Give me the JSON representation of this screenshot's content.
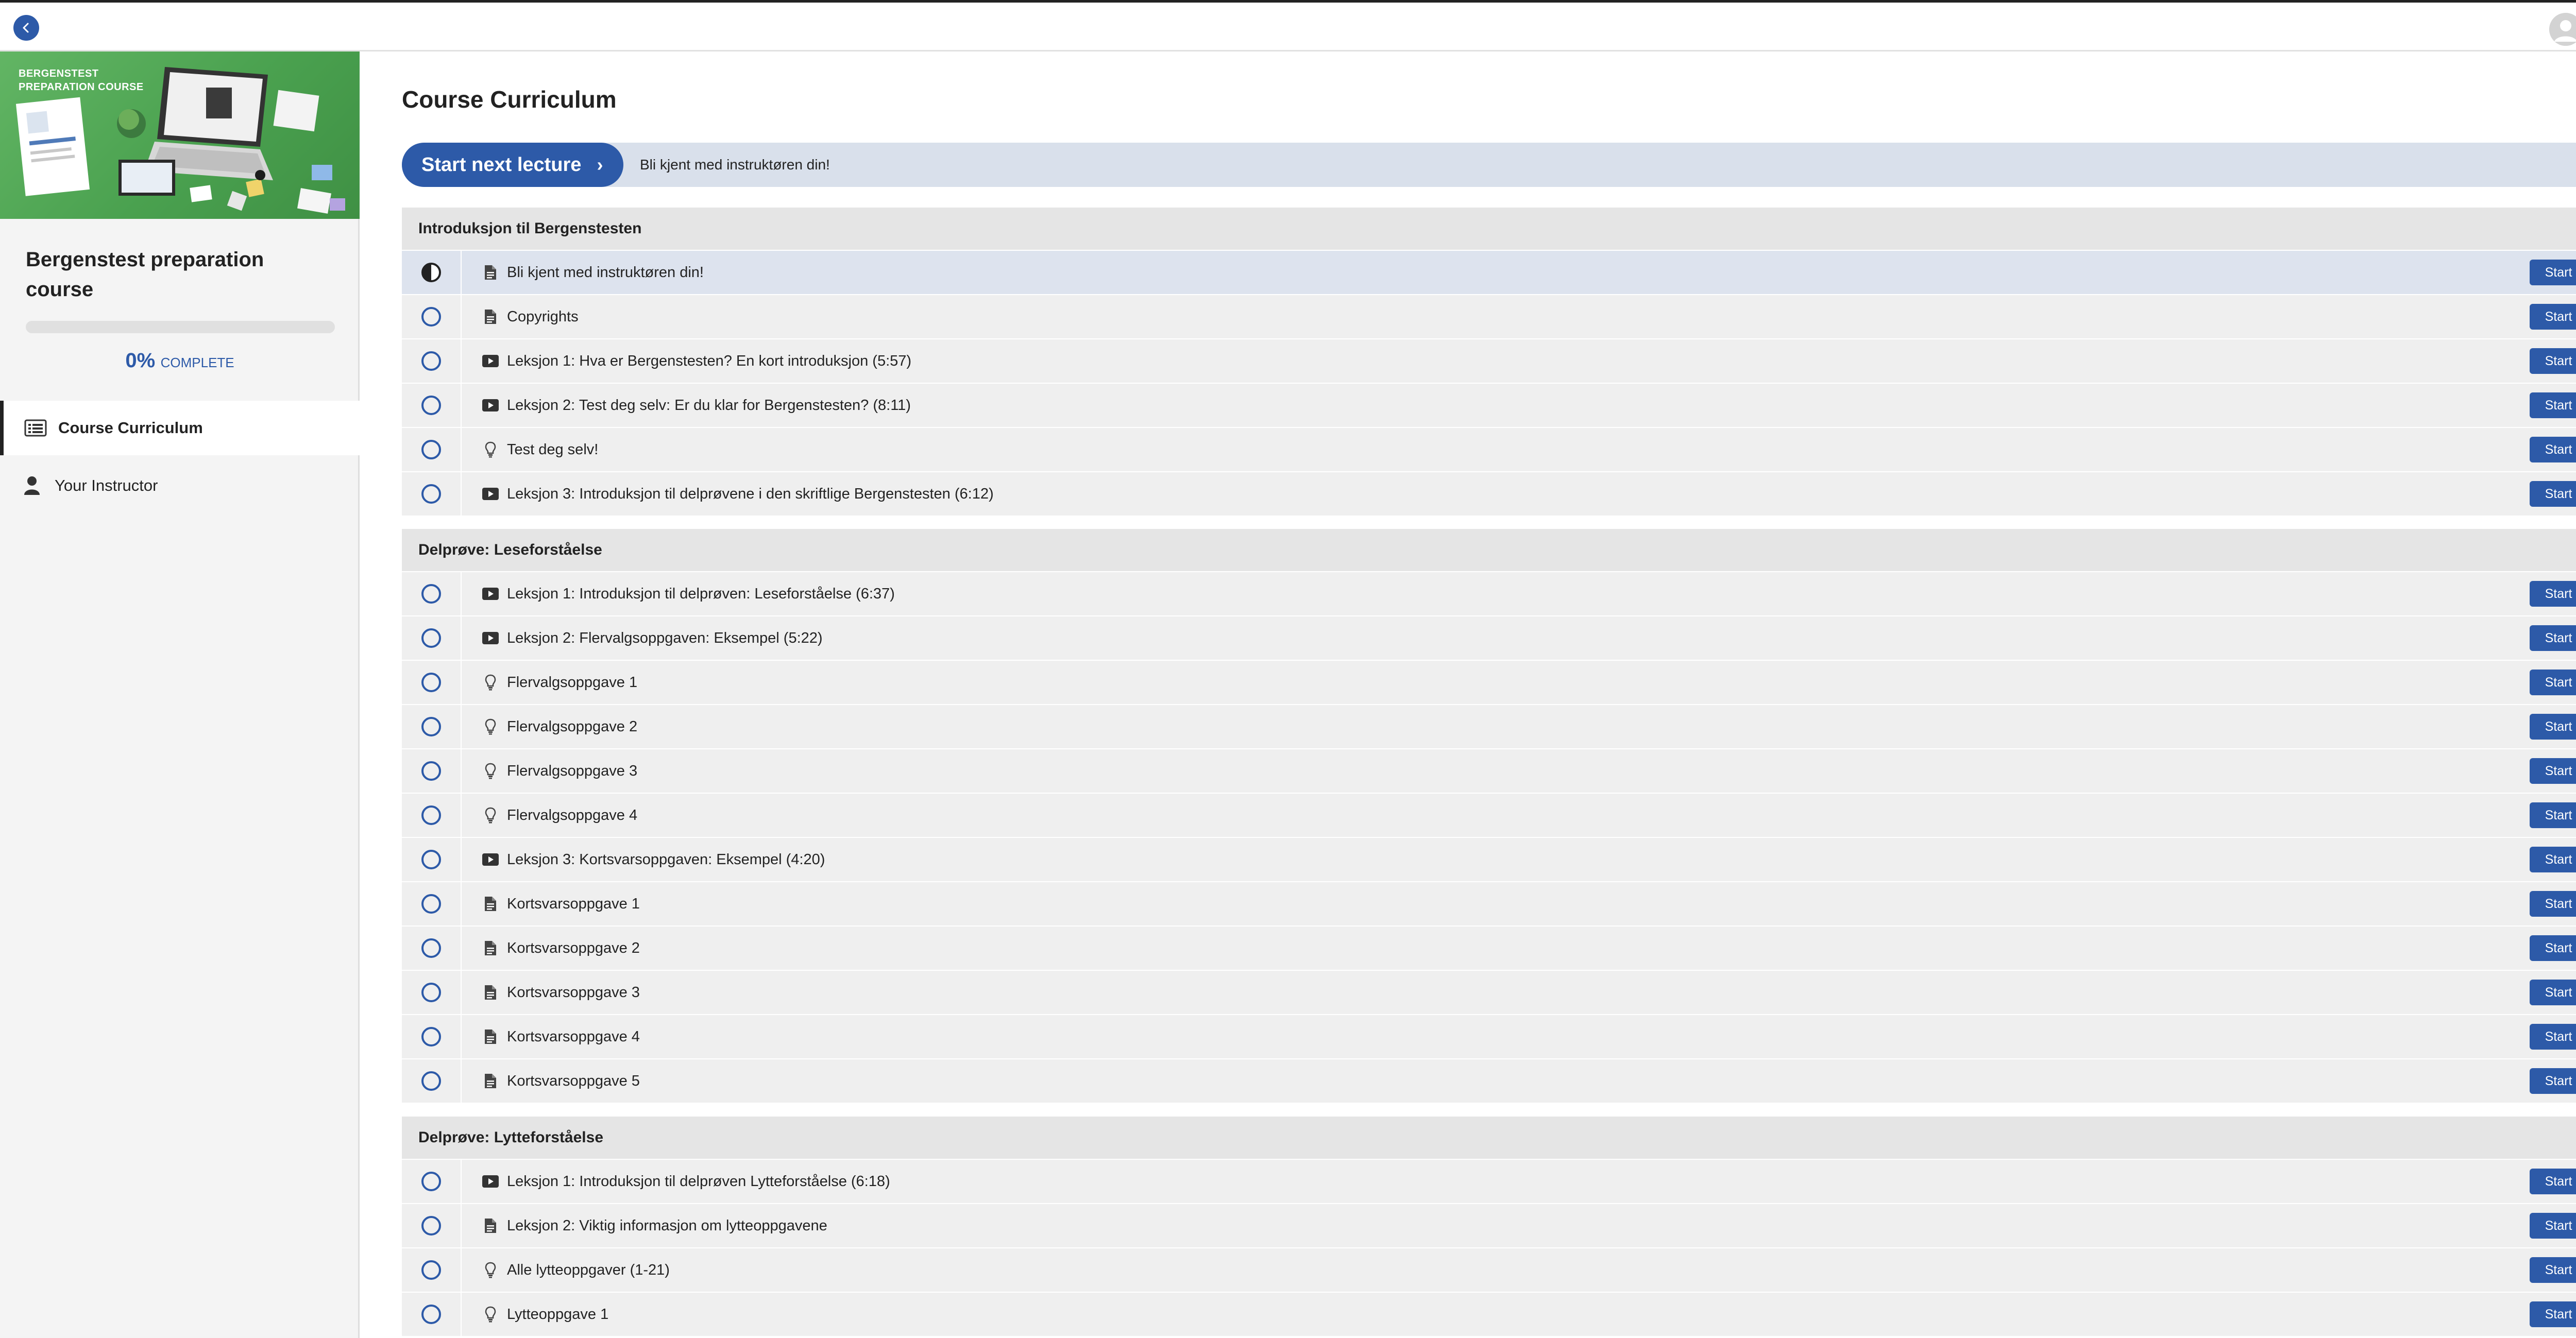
{
  "header": {
    "back_icon": "chevron-left-icon",
    "avatar_icon": "user-avatar-icon"
  },
  "sidebar": {
    "course_image_text": "BERGENSTEST\nPREPARATION COURSE",
    "course_title": "Bergenstest preparation course",
    "progress_percent": "0%",
    "progress_label": "COMPLETE",
    "progress_value": 0,
    "nav": [
      {
        "label": "Course Curriculum",
        "icon": "curriculum-list-icon",
        "active": true
      },
      {
        "label": "Your Instructor",
        "icon": "user-icon",
        "active": false
      }
    ]
  },
  "main": {
    "page_title": "Course Curriculum",
    "next_lecture_label": "Start next lecture",
    "next_lecture_title": "Bli kjent med instruktøren din!",
    "start_label": "Start",
    "sections": [
      {
        "title": "Introduksjon til Bergenstesten",
        "items": [
          {
            "title": "Bli kjent med instruktøren din!",
            "type": "document",
            "status": "in-progress"
          },
          {
            "title": "Copyrights",
            "type": "document",
            "status": "not-started"
          },
          {
            "title": "Leksjon 1: Hva er Bergenstesten? En kort introduksjon (5:57)",
            "type": "video",
            "status": "not-started"
          },
          {
            "title": "Leksjon 2: Test deg selv: Er du klar for Bergenstesten? (8:11)",
            "type": "video",
            "status": "not-started"
          },
          {
            "title": "Test deg selv!",
            "type": "quiz",
            "status": "not-started"
          },
          {
            "title": "Leksjon 3: Introduksjon til delprøvene i den skriftlige Bergenstesten (6:12)",
            "type": "video",
            "status": "not-started"
          }
        ]
      },
      {
        "title": "Delprøve: Leseforståelse",
        "items": [
          {
            "title": "Leksjon 1: Introduksjon til delprøven: Leseforståelse (6:37)",
            "type": "video",
            "status": "not-started"
          },
          {
            "title": "Leksjon 2: Flervalgsoppgaven: Eksempel (5:22)",
            "type": "video",
            "status": "not-started"
          },
          {
            "title": "Flervalgsoppgave 1",
            "type": "quiz",
            "status": "not-started"
          },
          {
            "title": "Flervalgsoppgave 2",
            "type": "quiz",
            "status": "not-started"
          },
          {
            "title": "Flervalgsoppgave 3",
            "type": "quiz",
            "status": "not-started"
          },
          {
            "title": "Flervalgsoppgave 4",
            "type": "quiz",
            "status": "not-started"
          },
          {
            "title": "Leksjon 3: Kortsvarsoppgaven: Eksempel (4:20)",
            "type": "video",
            "status": "not-started"
          },
          {
            "title": "Kortsvarsoppgave 1",
            "type": "document",
            "status": "not-started"
          },
          {
            "title": "Kortsvarsoppgave 2",
            "type": "document",
            "status": "not-started"
          },
          {
            "title": "Kortsvarsoppgave 3",
            "type": "document",
            "status": "not-started"
          },
          {
            "title": "Kortsvarsoppgave 4",
            "type": "document",
            "status": "not-started"
          },
          {
            "title": "Kortsvarsoppgave 5",
            "type": "document",
            "status": "not-started"
          }
        ]
      },
      {
        "title": "Delprøve: Lytteforståelse",
        "items": [
          {
            "title": "Leksjon 1: Introduksjon til delprøven Lytteforståelse (6:18)",
            "type": "video",
            "status": "not-started"
          },
          {
            "title": "Leksjon 2: Viktig informasjon om lytteoppgavene",
            "type": "document",
            "status": "not-started"
          },
          {
            "title": "Alle lytteoppgaver (1-21)",
            "type": "quiz",
            "status": "not-started"
          },
          {
            "title": "Lytteoppgave 1",
            "type": "quiz",
            "status": "not-started"
          }
        ]
      }
    ]
  },
  "colors": {
    "accent": "#2d5aa8",
    "row_bg": "#efefef",
    "current_row_bg": "#dde3ee",
    "section_bg": "#e5e5e5"
  }
}
